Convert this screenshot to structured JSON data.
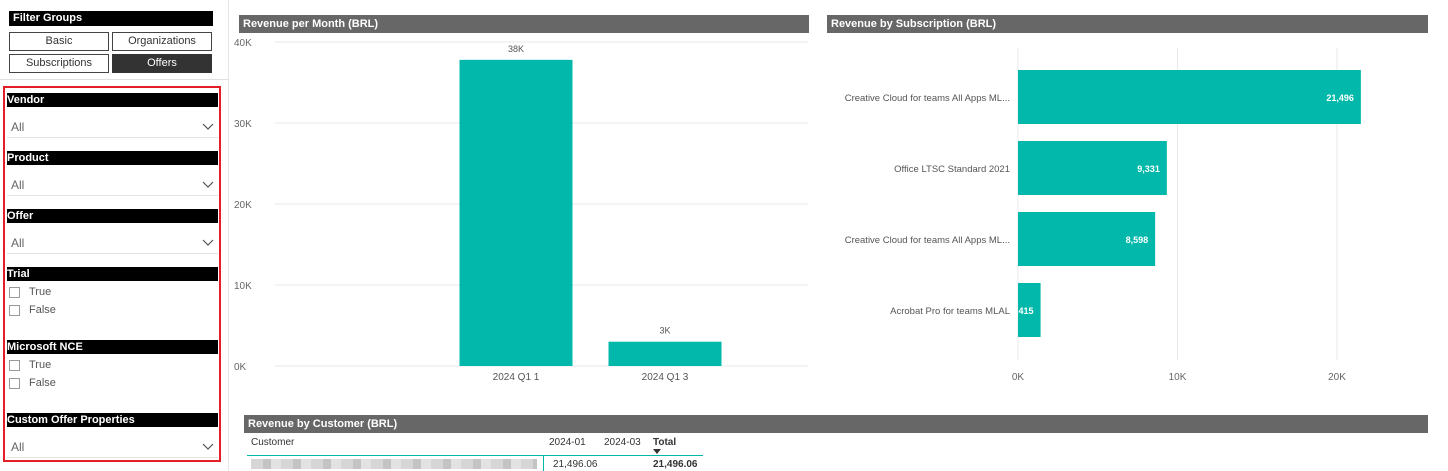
{
  "filter_groups": {
    "title": "Filter Groups",
    "buttons": [
      {
        "label": "Basic",
        "active": false
      },
      {
        "label": "Organizations",
        "active": false
      },
      {
        "label": "Subscriptions",
        "active": false
      },
      {
        "label": "Offers",
        "active": true
      }
    ]
  },
  "filters": {
    "vendor": {
      "label": "Vendor",
      "value": "All"
    },
    "product": {
      "label": "Product",
      "value": "All"
    },
    "offer": {
      "label": "Offer",
      "value": "All"
    },
    "trial": {
      "label": "Trial",
      "options": [
        "True",
        "False"
      ]
    },
    "microsoft_nce": {
      "label": "Microsoft NCE",
      "options": [
        "True",
        "False"
      ]
    },
    "custom_offer_properties": {
      "label": "Custom Offer Properties",
      "value": "All"
    }
  },
  "revenue_per_month": {
    "title": "Revenue per Month (BRL)",
    "chart_data": {
      "type": "bar",
      "categories": [
        "2024 Q1 1",
        "2024 Q1 3"
      ],
      "values": [
        37800,
        3000
      ],
      "data_labels": [
        "38K",
        "3K"
      ],
      "y_ticks": [
        "0K",
        "10K",
        "20K",
        "30K",
        "40K"
      ],
      "ylim": [
        0,
        40000
      ],
      "grid": true,
      "color": "#01b8aa"
    }
  },
  "revenue_by_subscription": {
    "title": "Revenue by Subscription (BRL)",
    "chart_data": {
      "type": "bar",
      "orientation": "horizontal",
      "categories": [
        "Creative Cloud for teams All Apps ML...",
        "Office LTSC Standard 2021",
        "Creative Cloud for teams All Apps ML...",
        "Acrobat Pro for teams MLAL"
      ],
      "values": [
        21496,
        9331,
        8598,
        1415
      ],
      "data_labels": [
        "21,496",
        "9,331",
        "8,598",
        "1,415"
      ],
      "x_ticks": [
        "0K",
        "10K",
        "20K"
      ],
      "xlim": [
        0,
        23000
      ],
      "grid": true,
      "color": "#01b8aa"
    }
  },
  "revenue_by_customer": {
    "title": "Revenue by Customer (BRL)",
    "columns": [
      "Customer",
      "2024-01",
      "2024-03",
      "Total"
    ],
    "rows": [
      {
        "customer": "",
        "v2024_01": "21,496.06",
        "v2024_03": "",
        "total": "21,496.06"
      }
    ]
  }
}
